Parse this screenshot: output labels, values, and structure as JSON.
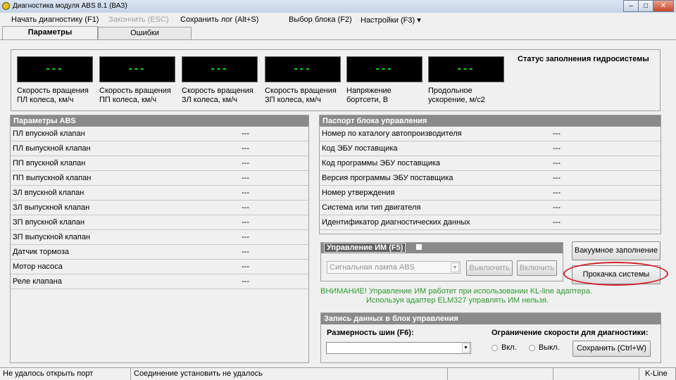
{
  "window": {
    "title": "Диагностика модуля ABS 8.1 (ВАЗ)",
    "min": "–",
    "max": "□",
    "close": "✕"
  },
  "menu": [
    {
      "label": "Начать диагностику (F1)",
      "enabled": true
    },
    {
      "label": "Закончить (ESC)",
      "enabled": false
    },
    {
      "label": "Сохранить лог (Alt+S)",
      "enabled": true
    },
    {
      "label": "Выбор блока (F2)",
      "enabled": true
    },
    {
      "label": "Настройки (F3) ▾",
      "enabled": true
    }
  ],
  "tabs": [
    {
      "label": "Параметры",
      "active": true
    },
    {
      "label": "Ошибки",
      "active": false
    }
  ],
  "gauges": [
    {
      "value": "---",
      "label": "Скорость вращения ПЛ колеса, км/ч"
    },
    {
      "value": "---",
      "label": "Скорость вращения ПП колеса, км/ч"
    },
    {
      "value": "---",
      "label": "Скорость вращения ЗЛ колеса, км/ч"
    },
    {
      "value": "---",
      "label": "Скорость вращения ЗП колеса, км/ч"
    },
    {
      "value": "---",
      "label": "Напряжение бортсети, В"
    },
    {
      "value": "---",
      "label": "Продольное ускорение, м/с2"
    }
  ],
  "hydro_status": "Статус заполнения гидросистемы",
  "abs_params": {
    "title": "Параметры ABS",
    "rows": [
      {
        "name": "ПЛ впускной клапан",
        "value": "---"
      },
      {
        "name": "ПЛ выпускной клапан",
        "value": "---"
      },
      {
        "name": "ПП впускной клапан",
        "value": "---"
      },
      {
        "name": "ПП выпускной клапан",
        "value": "---"
      },
      {
        "name": "ЗЛ впускной клапан",
        "value": "---"
      },
      {
        "name": "ЗЛ выпускной клапан",
        "value": "---"
      },
      {
        "name": "ЗП впускной клапан",
        "value": "---"
      },
      {
        "name": "ЗП выпускной клапан",
        "value": "---"
      },
      {
        "name": "Датчик тормоза",
        "value": "---"
      },
      {
        "name": "Мотор насоса",
        "value": "---"
      },
      {
        "name": "Реле клапана",
        "value": "---"
      }
    ]
  },
  "passport": {
    "title": "Паспорт блока управления",
    "rows": [
      {
        "name": "Номер по каталогу автопроизводителя",
        "value": "---"
      },
      {
        "name": "Код ЭБУ поставщика",
        "value": "---"
      },
      {
        "name": "Код программы ЭБУ поставщика",
        "value": "---"
      },
      {
        "name": "Версия программы ЭБУ поставщика",
        "value": "---"
      },
      {
        "name": "Номер утверждения",
        "value": "---"
      },
      {
        "name": "Система или тип двигателя",
        "value": "---"
      },
      {
        "name": "Идентификатор диагностических данных",
        "value": "---"
      }
    ]
  },
  "im_control": {
    "title": "Управление ИМ (F5)",
    "select": "Сигнальная лампа ABS",
    "off": "Выключить",
    "on": "Включить"
  },
  "vacuum_button": "Вакуумное заполнение",
  "bleed_button": "Прокачка системы",
  "highlight_color": "#d0202a",
  "warning": {
    "line1": "ВНИМАНИЕ! Управление ИМ работет при использовании KL-line адаптера.",
    "line2": "Используя адаптер ELM327 управлять ИМ нельзя."
  },
  "record": {
    "title": "Запись данных в блок управления",
    "tire_label": "Размерность шин (F6):",
    "tire_value": "",
    "speed_label": "Ограничение скорости для диагностики:",
    "radio_on": "Вкл.",
    "radio_off": "Выкл.",
    "save": "Сохранить  (Ctrl+W)"
  },
  "status": {
    "port": "Не удалось открыть порт",
    "connection": "Соединение установить не удалось",
    "interface": "K-Line"
  }
}
